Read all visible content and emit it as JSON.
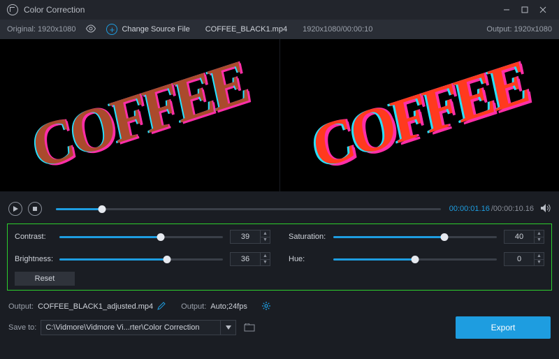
{
  "window": {
    "title": "Color Correction"
  },
  "header": {
    "original_label": "Original: 1920x1080",
    "change_source": "Change Source File",
    "filename": "COFFEE_BLACK1.mp4",
    "resolution_time": "1920x1080/00:00:10",
    "output_label": "Output: 1920x1080"
  },
  "preview_text": "COFFEE",
  "transport": {
    "seek_pct": 12,
    "current": "00:00:01.16",
    "total": "/00:00:10.16"
  },
  "sliders": {
    "contrast": {
      "label": "Contrast:",
      "value": "39",
      "pct": 62
    },
    "brightness": {
      "label": "Brightness:",
      "value": "36",
      "pct": 66
    },
    "saturation": {
      "label": "Saturation:",
      "value": "40",
      "pct": 68
    },
    "hue": {
      "label": "Hue:",
      "value": "0",
      "pct": 50
    }
  },
  "reset_label": "Reset",
  "output": {
    "label": "Output:",
    "filename": "COFFEE_BLACK1_adjusted.mp4",
    "label2": "Output:",
    "format": "Auto;24fps"
  },
  "save": {
    "label": "Save to:",
    "path": "C:\\Vidmore\\Vidmore Vi...rter\\Color Correction"
  },
  "export_label": "Export"
}
